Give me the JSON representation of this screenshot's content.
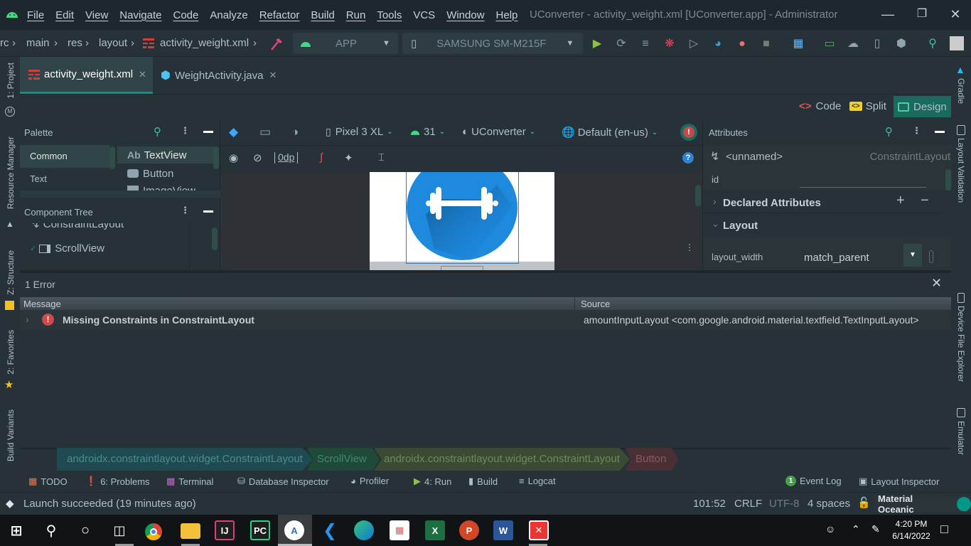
{
  "window": {
    "title": "UConverter - activity_weight.xml [UConverter.app] - Administrator",
    "menu": [
      "File",
      "Edit",
      "View",
      "Navigate",
      "Code",
      "Analyze",
      "Refactor",
      "Build",
      "Run",
      "Tools",
      "VCS",
      "Window",
      "Help"
    ]
  },
  "navbar": {
    "breadcrumbs": [
      "rc",
      "main",
      "res",
      "layout",
      "activity_weight.xml"
    ],
    "run_config": "APP",
    "device": "SAMSUNG SM-M215F"
  },
  "left_tool_windows": [
    "1: Project",
    "Resource Manager",
    "Z: Structure",
    "2: Favorites",
    "Build Variants"
  ],
  "right_tool_windows": [
    "Gradle",
    "Layout Validation",
    "Device File Explorer",
    "Emulator"
  ],
  "editor_tabs": [
    {
      "label": "activity_weight.xml",
      "active": true
    },
    {
      "label": "WeightActivity.java",
      "active": false
    }
  ],
  "view_modes": {
    "code": "Code",
    "split": "Split",
    "design": "Design",
    "active": "Design"
  },
  "palette": {
    "title": "Palette",
    "categories": [
      "Common",
      "Text"
    ],
    "selected_category": "Common",
    "widgets": [
      {
        "icon": "Ab",
        "label": "TextView"
      },
      {
        "icon": "button",
        "label": "Button"
      },
      {
        "icon": "image",
        "label": "ImageView"
      }
    ]
  },
  "component_tree": {
    "title": "Component Tree",
    "items": [
      "ConstraintLayout",
      "ScrollView"
    ]
  },
  "design_toolbar": {
    "device": "Pixel 3 XL",
    "api": "31",
    "theme": "UConverter",
    "locale": "Default (en-us)",
    "margin": "0dp"
  },
  "attributes": {
    "title": "Attributes",
    "component_name": "<unnamed>",
    "component_type": "ConstraintLayout",
    "id_label": "id",
    "id_value": "",
    "sections": [
      {
        "label": "Declared Attributes",
        "expanded": false
      },
      {
        "label": "Layout",
        "expanded": true
      }
    ],
    "layout_width_label": "layout_width",
    "layout_width_value": "match_parent"
  },
  "problems": {
    "title": "1 Error",
    "col_message": "Message",
    "col_source": "Source",
    "rows": [
      {
        "message": "Missing Constraints in ConstraintLayout",
        "source": "amountInputLayout <com.google.android.material.textfield.TextInputLayout>",
        "severity": "error"
      }
    ]
  },
  "component_breadcrumbs": [
    "androidx.constraintlayout.widget.ConstraintLayout",
    "ScrollView",
    "androidx.constraintlayout.widget.ConstraintLayout",
    "Button"
  ],
  "tool_windows": [
    "TODO",
    "6: Problems",
    "Terminal",
    "Database Inspector",
    "Profiler",
    "4: Run",
    "Build",
    "Logcat"
  ],
  "tool_windows_right": {
    "event_log": "Event Log",
    "event_count": "1",
    "layout_inspector": "Layout Inspector"
  },
  "status": {
    "message": "Launch succeeded (19 minutes ago)",
    "position": "101:52",
    "line_sep": "CRLF",
    "encoding": "UTF-8",
    "indent": "4 spaces",
    "theme": "Material Oceanic"
  },
  "taskbar": {
    "apps": [
      "Start",
      "Search",
      "Cortana",
      "Task View",
      "Chrome",
      "File Explorer",
      "IntelliJ IDEA",
      "PyCharm",
      "Android Studio",
      "VS Code",
      "Edge",
      "Store",
      "Excel",
      "PowerPoint",
      "Word",
      "Antivirus"
    ],
    "time": "4:20 PM",
    "date": "6/14/2022"
  },
  "colors": {
    "accent": "#009688",
    "error": "#e05555"
  }
}
